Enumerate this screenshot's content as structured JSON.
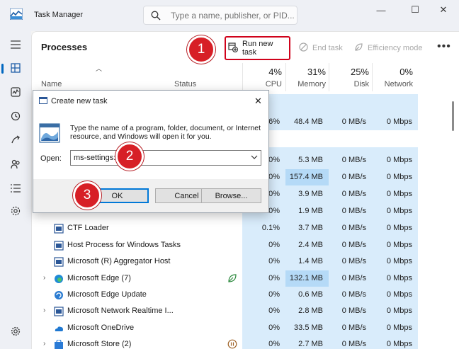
{
  "app": {
    "title": "Task Manager"
  },
  "search": {
    "placeholder": "Type a name, publisher, or PID..."
  },
  "window_controls": {
    "minimize": "—",
    "maximize": "☐",
    "close": "✕"
  },
  "page": {
    "title": "Processes"
  },
  "toolbar": {
    "run_new_task": "Run new task",
    "end_task": "End task",
    "efficiency_mode": "Efficiency mode",
    "more": "•••"
  },
  "columns": {
    "name": "Name",
    "status": "Status",
    "cpu": {
      "percent": "4%",
      "label": "CPU"
    },
    "memory": {
      "percent": "31%",
      "label": "Memory"
    },
    "disk": {
      "percent": "25%",
      "label": "Disk"
    },
    "network": {
      "percent": "0%",
      "label": "Network"
    }
  },
  "hidden_rows": [
    {
      "cpu": "0.6%",
      "memory": "48.4 MB",
      "disk": "0 MB/s",
      "network": "0 Mbps"
    },
    {
      "cpu": "0%",
      "memory": "5.3 MB",
      "disk": "0 MB/s",
      "network": "0 Mbps"
    },
    {
      "cpu": "0%",
      "memory": "157.4 MB",
      "disk": "0 MB/s",
      "network": "0 Mbps"
    },
    {
      "cpu": "0%",
      "memory": "3.9 MB",
      "disk": "0 MB/s",
      "network": "0 Mbps"
    },
    {
      "cpu": "0%",
      "memory": "1.9 MB",
      "disk": "0 MB/s",
      "network": "0 Mbps"
    }
  ],
  "processes": [
    {
      "name": "CTF Loader",
      "cpu": "0.1%",
      "memory": "3.7 MB",
      "disk": "0 MB/s",
      "network": "0 Mbps"
    },
    {
      "name": "Host Process for Windows Tasks",
      "cpu": "0%",
      "memory": "2.4 MB",
      "disk": "0 MB/s",
      "network": "0 Mbps"
    },
    {
      "name": "Microsoft (R) Aggregator Host",
      "cpu": "0%",
      "memory": "1.4 MB",
      "disk": "0 MB/s",
      "network": "0 Mbps"
    },
    {
      "name": "Microsoft Edge (7)",
      "cpu": "0%",
      "memory": "132.1 MB",
      "disk": "0 MB/s",
      "network": "0 Mbps"
    },
    {
      "name": "Microsoft Edge Update",
      "cpu": "0%",
      "memory": "0.6 MB",
      "disk": "0 MB/s",
      "network": "0 Mbps"
    },
    {
      "name": "Microsoft Network Realtime I...",
      "cpu": "0%",
      "memory": "2.8 MB",
      "disk": "0 MB/s",
      "network": "0 Mbps"
    },
    {
      "name": "Microsoft OneDrive",
      "cpu": "0%",
      "memory": "33.5 MB",
      "disk": "0 MB/s",
      "network": "0 Mbps"
    },
    {
      "name": "Microsoft Store (2)",
      "cpu": "0%",
      "memory": "2.7 MB",
      "disk": "0 MB/s",
      "network": "0 Mbps"
    }
  ],
  "dialog": {
    "title": "Create new task",
    "description": "Type the name of a program, folder, document, or Internet resource, and Windows will open it for you.",
    "open_label": "Open:",
    "open_value": "ms-settings:",
    "ok": "OK",
    "cancel": "Cancel",
    "browse": "Browse..."
  },
  "callouts": {
    "one": "1",
    "two": "2",
    "three": "3"
  },
  "colors": {
    "accent": "#0067c0",
    "callout": "#d71f26",
    "cpu_highlight": "#d9ecfb",
    "mem_highlight": "#b5daf7"
  }
}
